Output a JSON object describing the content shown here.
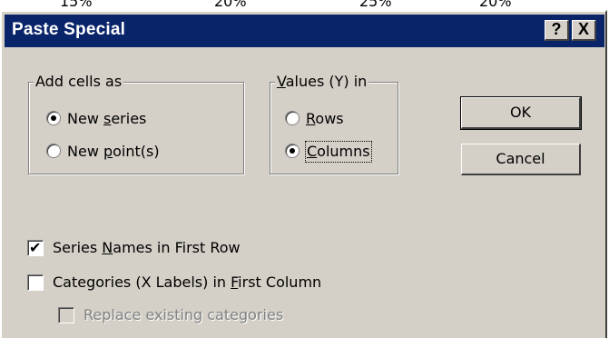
{
  "background": {
    "cropped_text": [
      "15%",
      "20%",
      "25%",
      "20%"
    ]
  },
  "dialog": {
    "title": "Paste Special",
    "help_glyph": "?",
    "close_glyph": "X"
  },
  "add_cells": {
    "label": "Add cells as",
    "options": [
      {
        "text": "New ",
        "accel": "s",
        "rest": "eries",
        "selected": true
      },
      {
        "text": "New ",
        "accel": "p",
        "rest": "oint(s)",
        "selected": false
      }
    ]
  },
  "values_in": {
    "label_accel": "V",
    "label_rest": "alues (Y) in",
    "options": [
      {
        "text": "",
        "accel": "R",
        "rest": "ows",
        "selected": false
      },
      {
        "text": "",
        "accel": "C",
        "rest": "olumns",
        "selected": true
      }
    ]
  },
  "buttons": {
    "ok": "OK",
    "cancel": "Cancel"
  },
  "checkboxes": [
    {
      "pre": "Series ",
      "accel": "N",
      "post": "ames in First Row",
      "checked": true,
      "enabled": true
    },
    {
      "pre": "Categories (X Labels) in ",
      "accel": "F",
      "post": "irst Column",
      "checked": false,
      "enabled": true
    },
    {
      "pre": "Replace existing categories",
      "accel": "",
      "post": "",
      "checked": false,
      "enabled": false
    }
  ],
  "colors": {
    "titlebar": "#0a246a",
    "face": "#d4d0c8",
    "disabled_text": "#808080"
  }
}
